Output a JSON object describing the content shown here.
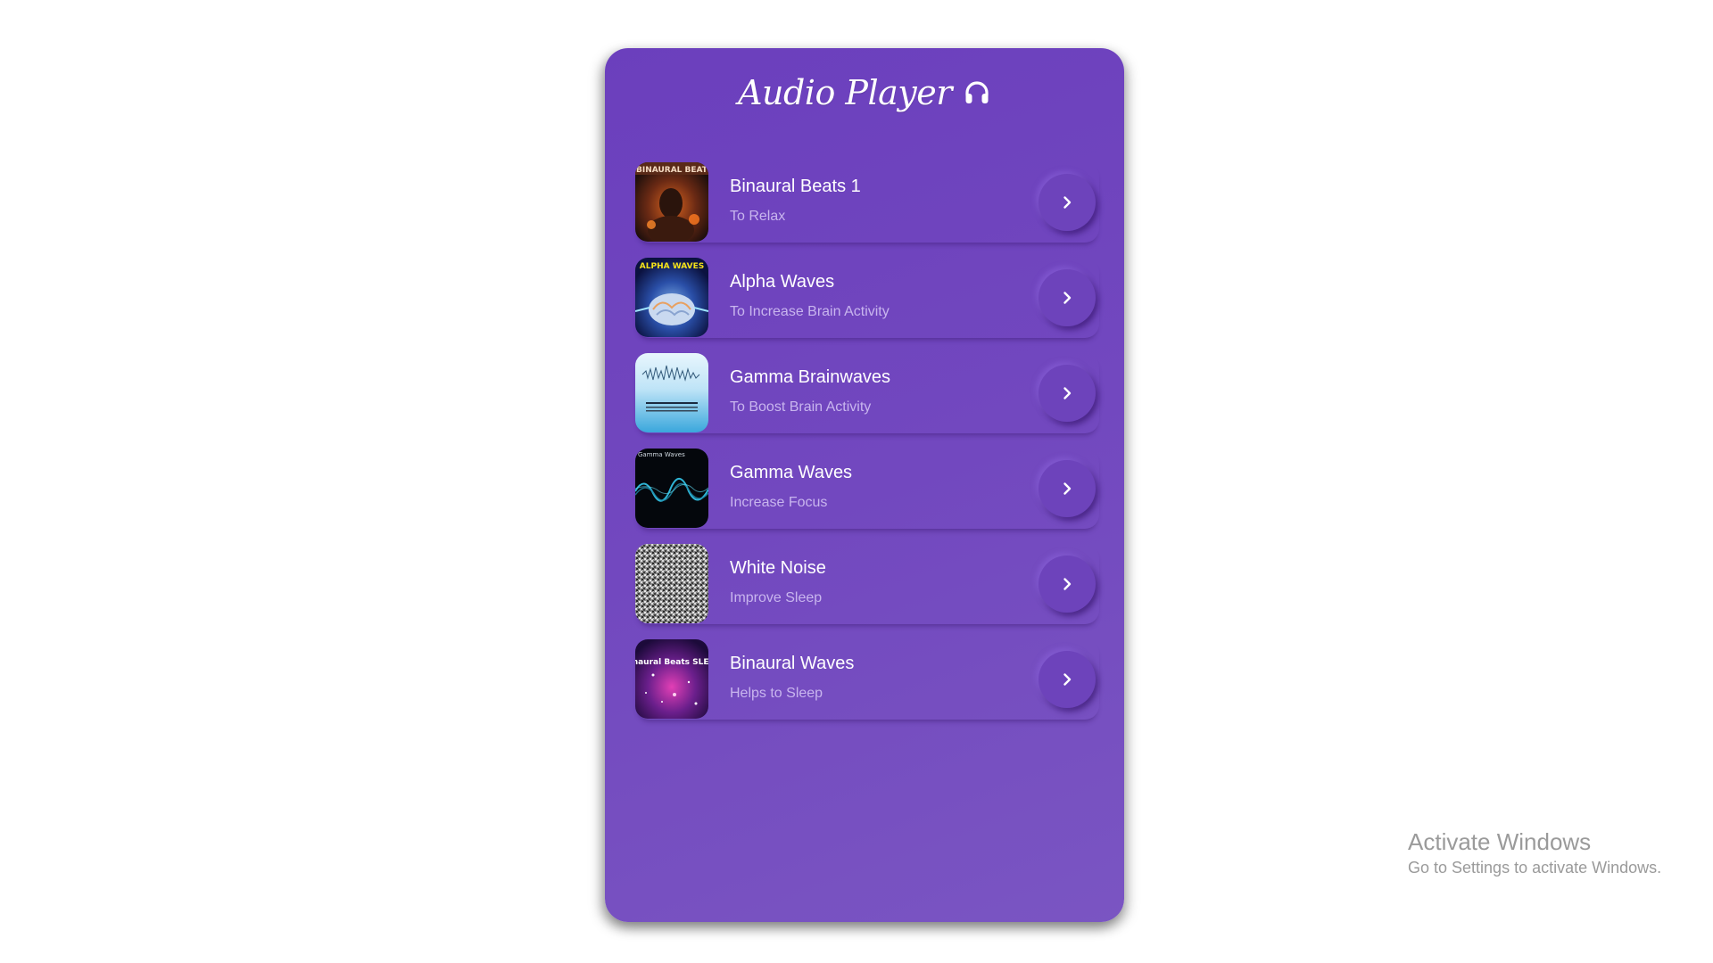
{
  "app": {
    "title": "Audio Player",
    "title_icon": "headphones-icon"
  },
  "tracks": [
    {
      "title": "Binaural Beats 1",
      "subtitle": "To Relax",
      "thumb_text": "BINAURAL BEAT",
      "action_icon": "chevron-right-icon"
    },
    {
      "title": "Alpha Waves",
      "subtitle": "To Increase Brain Activity",
      "thumb_text": "ALPHA WAVES",
      "action_icon": "chevron-right-icon"
    },
    {
      "title": "Gamma Brainwaves",
      "subtitle": "To Boost Brain Activity",
      "thumb_text": "",
      "action_icon": "chevron-right-icon"
    },
    {
      "title": "Gamma Waves",
      "subtitle": "Increase Focus",
      "thumb_text": "Gamma Waves",
      "action_icon": "chevron-right-icon"
    },
    {
      "title": "White Noise",
      "subtitle": "Improve Sleep",
      "thumb_text": "",
      "action_icon": "chevron-right-icon"
    },
    {
      "title": "Binaural Waves",
      "subtitle": "Helps to Sleep",
      "thumb_text": "Binaural Beats SLEEP",
      "action_icon": "chevron-right-icon"
    }
  ],
  "watermark": {
    "title": "Activate Windows",
    "subtitle": "Go to Settings to activate Windows."
  },
  "colors": {
    "panel": "#6b3fbd",
    "button": "#6d43bb",
    "subtitle_text": "#c8b5ee",
    "title_text": "#ffffff"
  }
}
